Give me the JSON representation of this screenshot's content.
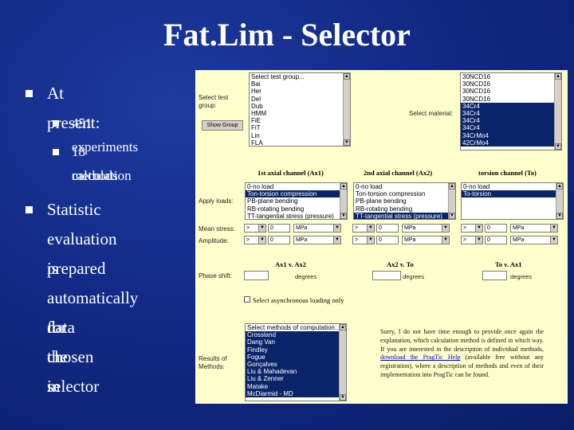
{
  "slide": {
    "title": "Fat.Lim - Selector",
    "bullets": [
      {
        "text": "At present:"
      },
      {
        "text": "451 experiments"
      },
      {
        "text": "18 calculation"
      },
      {
        "text": "methods"
      },
      {
        "text": "Statistic"
      },
      {
        "text": "evaluation is"
      },
      {
        "text": "prepared"
      },
      {
        "text": "automatically for"
      },
      {
        "text": "data chosen in"
      },
      {
        "text": "the selector"
      }
    ]
  },
  "selector": {
    "test_group_label_1": "Select test",
    "test_group_label_2": "group:",
    "test_groups": [
      "Select test group...",
      "Bai",
      "Her",
      "Del",
      "Dub",
      "HMM",
      "FiE",
      "FiT",
      "Lin",
      "FLA"
    ],
    "show_group_button": "Show Group",
    "material_label": "Select material:",
    "materials": [
      "30NCD16",
      "30NCD16",
      "30NCD16",
      "30NCD16",
      "34Cr4",
      "34Cr4",
      "34Cr4",
      "34Cr4",
      "34CrMo4",
      "42CrMo4"
    ],
    "materials_selected": [
      false,
      false,
      false,
      false,
      true,
      true,
      true,
      true,
      true,
      true
    ],
    "channel_headers": [
      "1st axial channel (Ax1)",
      "2nd axial channel (Ax2)",
      "torsion channel (To)"
    ],
    "apply_loads_label": "Apply loads:",
    "ax1_loads": [
      "0-no load",
      "Ton-torsion compression",
      "PB-plane bending",
      "RB-rotating bending",
      "TT-tangential stress (pressure)"
    ],
    "ax2_loads": [
      "0-no load",
      "Ton-torsion compression",
      "PB-plane bending",
      "RB-rotating bending",
      "TT-tangential stress (pressure)"
    ],
    "to_loads": [
      "0-no load",
      "To-torsion"
    ],
    "mean_stress_label": "Mean stress:",
    "amplitude_label": "Amplitude:",
    "mean_stress": [
      {
        "op": ">",
        "value": "0",
        "unit": "MPa"
      },
      {
        "op": ">",
        "value": "0",
        "unit": "MPa"
      },
      {
        "op": ">",
        "value": "0",
        "unit": "MPa"
      }
    ],
    "amplitude": [
      {
        "op": ">",
        "value": "0",
        "unit": "MPa"
      },
      {
        "op": ">",
        "value": "0",
        "unit": "MPa"
      },
      {
        "op": ">",
        "value": "0",
        "unit": "MPa"
      }
    ],
    "phase_headers": [
      "Ax1 v. Ax2",
      "Ax2 v. To",
      "To v. Ax1"
    ],
    "phase_label": "Phase shift:",
    "phase_unit": "degrees",
    "async_label": "Select asynchronous loading only",
    "results_label_1": "Results of",
    "results_label_2": "Methods:",
    "methods": [
      "Select methods of computation...",
      "Crossland",
      "Dang Van",
      "Findley",
      "Fogue",
      "Gonçalves",
      "Liu & Mahadevan",
      "Liu & Zenner",
      "Matake",
      "McDiarmid - MD"
    ],
    "methods_selected": [
      false,
      true,
      true,
      true,
      true,
      true,
      true,
      true,
      true,
      true
    ],
    "note_text_1": "Sorry, I do not have time enough to provide once again the explanation, which calculation method is defined in which way. If you are interested in the description of individual methods,",
    "note_link_1": "download the PragTic Help",
    "note_text_2": "(available free without any registration), where a description of methods and even of their implementation into PragTic can be found."
  }
}
